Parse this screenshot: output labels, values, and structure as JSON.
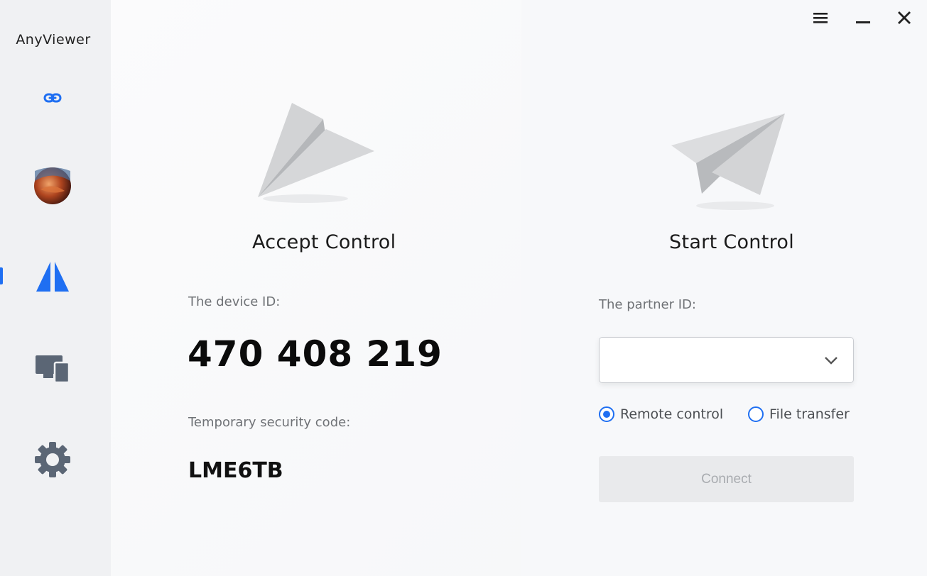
{
  "app": {
    "title": "AnyViewer"
  },
  "sidebar": {
    "items": [
      {
        "icon": "link-icon"
      },
      {
        "icon": "avatar"
      },
      {
        "icon": "connection-icon",
        "active": true
      },
      {
        "icon": "devices-icon"
      },
      {
        "icon": "gear-icon"
      }
    ]
  },
  "window_controls": {
    "menu": "menu-icon",
    "minimize": "minimize-icon",
    "close": "close-icon"
  },
  "accept": {
    "heading": "Accept Control",
    "device_id_label": "The device ID:",
    "device_id": "470 408 219",
    "security_code_label": "Temporary security code:",
    "security_code": "LME6TB"
  },
  "start": {
    "heading": "Start Control",
    "partner_id_label": "The partner ID:",
    "partner_id_value": "",
    "options": [
      {
        "label": "Remote control",
        "checked": true
      },
      {
        "label": "File transfer",
        "checked": false
      }
    ],
    "connect_label": "Connect"
  },
  "colors": {
    "accent": "#1f6ff2",
    "sidebar": "#f0f1f3",
    "icon_gray": "#5b6675"
  }
}
